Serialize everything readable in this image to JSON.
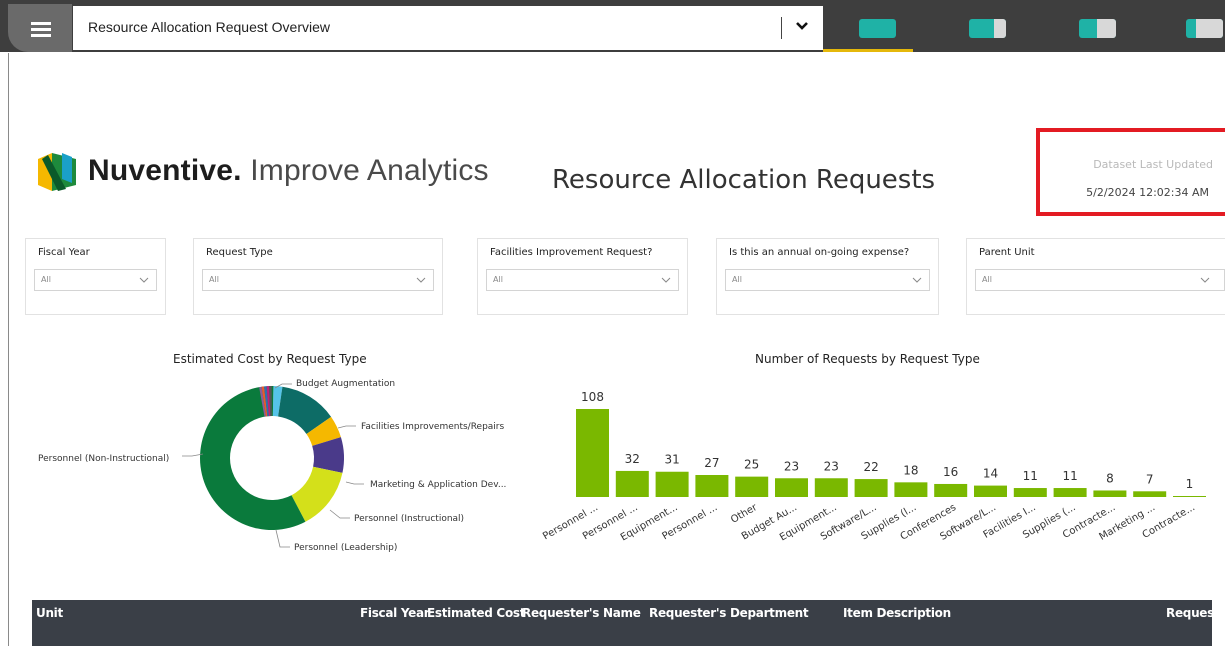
{
  "topbar": {
    "menu_icon": "hamburger-icon",
    "report_selector": {
      "value": "Resource Allocation Request Overview",
      "dropdown_icon": "chevron-down-icon"
    },
    "page_tabs": [
      {
        "name": "page-tab-1",
        "active": true
      },
      {
        "name": "page-tab-2",
        "active": false
      },
      {
        "name": "page-tab-3",
        "active": false
      },
      {
        "name": "page-tab-4",
        "active": false
      }
    ],
    "accent_color": "#e5b80b",
    "tab_icon_color": "#1fb2a6"
  },
  "header": {
    "brand_bold": "Nuventive.",
    "brand_rest": "Improve Analytics",
    "report_title": "Resource Allocation Requests",
    "dataset_updated_label": "Dataset Last Updated",
    "dataset_updated_value": "5/2/2024 12:02:34 AM",
    "highlight_color": "#e31b23"
  },
  "filters": [
    {
      "label": "Fiscal Year",
      "value": "All"
    },
    {
      "label": "Request Type",
      "value": "All"
    },
    {
      "label": "Facilities Improvement Request?",
      "value": "All"
    },
    {
      "label": "Is this an annual on-going expense?",
      "value": "All"
    },
    {
      "label": "Parent Unit",
      "value": "All"
    }
  ],
  "chart_data": [
    {
      "type": "pie",
      "title": "Estimated Cost by Request Type",
      "donut": true,
      "labels": [
        "Personnel (Non-Instructional)",
        "Budget Augmentation",
        "Facilities Improvements/Repairs",
        "Marketing & Application Dev...",
        "Personnel (Instructional)",
        "Personnel (Leadership)"
      ],
      "values": [
        58,
        2,
        13,
        5,
        8,
        14
      ],
      "colors": [
        "#0a7a3c",
        "#55c3e8",
        "#0d6c66",
        "#f5b800",
        "#4a3a8a",
        "#d4e01a"
      ]
    },
    {
      "type": "bar",
      "title": "Number of Requests by Request Type",
      "categories": [
        "Personnel ...",
        "Personnel ...",
        "Equipment...",
        "Personnel ...",
        "Other",
        "Budget Au...",
        "Equipment...",
        "Software/L...",
        "Supplies (l...",
        "Conferences",
        "Software/L...",
        "Facilities I...",
        "Supplies (...",
        "Contracte...",
        "Marketing ...",
        "Contracte..."
      ],
      "values": [
        108,
        32,
        31,
        27,
        25,
        23,
        23,
        22,
        18,
        16,
        14,
        11,
        11,
        8,
        7,
        1
      ],
      "color": "#7ab800",
      "ylim": [
        0,
        108
      ]
    }
  ],
  "table": {
    "columns": [
      "Unit",
      "Fiscal Year",
      "Estimated Cost",
      "Requester's Name",
      "Requester's Department",
      "Item Description",
      "Request"
    ]
  }
}
